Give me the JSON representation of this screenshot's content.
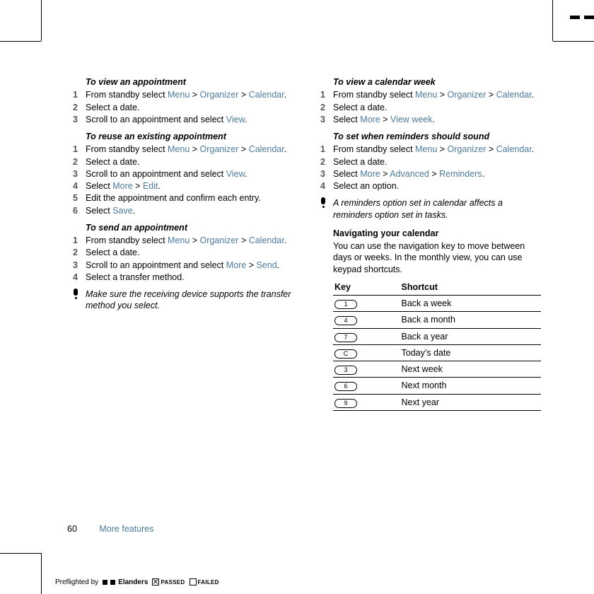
{
  "left": {
    "h1": "To view an appointment",
    "s1": [
      {
        "pre": "From standby select ",
        "links": [
          "Menu",
          " > ",
          "Organizer",
          " > ",
          "Calendar"
        ],
        "post": "."
      },
      {
        "pre": "Select a date."
      },
      {
        "pre": "Scroll to an appointment and select ",
        "links": [
          "View"
        ],
        "post": "."
      }
    ],
    "h2": "To reuse an existing appointment",
    "s2": [
      {
        "pre": "From standby select ",
        "links": [
          "Menu",
          " > ",
          "Organizer",
          " > ",
          "Calendar"
        ],
        "post": "."
      },
      {
        "pre": "Select a date."
      },
      {
        "pre": "Scroll to an appointment and select ",
        "links": [
          "View"
        ],
        "post": "."
      },
      {
        "pre": "Select ",
        "links": [
          "More",
          " > ",
          "Edit"
        ],
        "post": "."
      },
      {
        "pre": "Edit the appointment and confirm each entry."
      },
      {
        "pre": "Select ",
        "links": [
          "Save"
        ],
        "post": "."
      }
    ],
    "h3": "To send an appointment",
    "s3": [
      {
        "pre": "From standby select ",
        "links": [
          "Menu",
          " > ",
          "Organizer",
          " > ",
          "Calendar"
        ],
        "post": "."
      },
      {
        "pre": "Select a date."
      },
      {
        "pre": "Scroll to an appointment and select ",
        "links": [
          "More",
          " > ",
          "Send"
        ],
        "post": "."
      },
      {
        "pre": "Select a transfer method."
      }
    ],
    "note": "Make sure the receiving device supports the transfer method you select."
  },
  "right": {
    "h1": "To view a calendar week",
    "s1": [
      {
        "pre": "From standby select ",
        "links": [
          "Menu",
          " > ",
          "Organizer",
          " > ",
          "Calendar"
        ],
        "post": "."
      },
      {
        "pre": "Select a date."
      },
      {
        "pre": "Select ",
        "links": [
          "More",
          " > ",
          "View week"
        ],
        "post": "."
      }
    ],
    "h2": "To set when reminders should sound",
    "s2": [
      {
        "pre": "From standby select ",
        "links": [
          "Menu",
          " > ",
          "Organizer",
          " > ",
          "Calendar"
        ],
        "post": "."
      },
      {
        "pre": "Select a date."
      },
      {
        "pre": "Select ",
        "links": [
          "More",
          " > ",
          "Advanced",
          " > ",
          "Reminders"
        ],
        "post": "."
      },
      {
        "pre": "Select an option."
      }
    ],
    "note": "A reminders option set in calendar affects a reminders option set in tasks.",
    "navTitle": "Navigating your calendar",
    "navBody": "You can use the navigation key to move between days or weeks. In the monthly view, you can use keypad shortcuts.",
    "table": {
      "head": [
        "Key",
        "Shortcut"
      ],
      "rows": [
        {
          "key": "1",
          "label": "Back a week"
        },
        {
          "key": "4",
          "label": "Back a month"
        },
        {
          "key": "7",
          "label": "Back a year"
        },
        {
          "key": "C",
          "label": "Today's date"
        },
        {
          "key": "3",
          "label": "Next week"
        },
        {
          "key": "6",
          "label": "Next month"
        },
        {
          "key": "9",
          "label": "Next year"
        }
      ]
    }
  },
  "footer": {
    "page": "60",
    "section": "More features"
  },
  "preflight": {
    "by": "Preflighted by",
    "brand": "Elanders",
    "passed": "PASSED",
    "failed": "FAILED"
  }
}
